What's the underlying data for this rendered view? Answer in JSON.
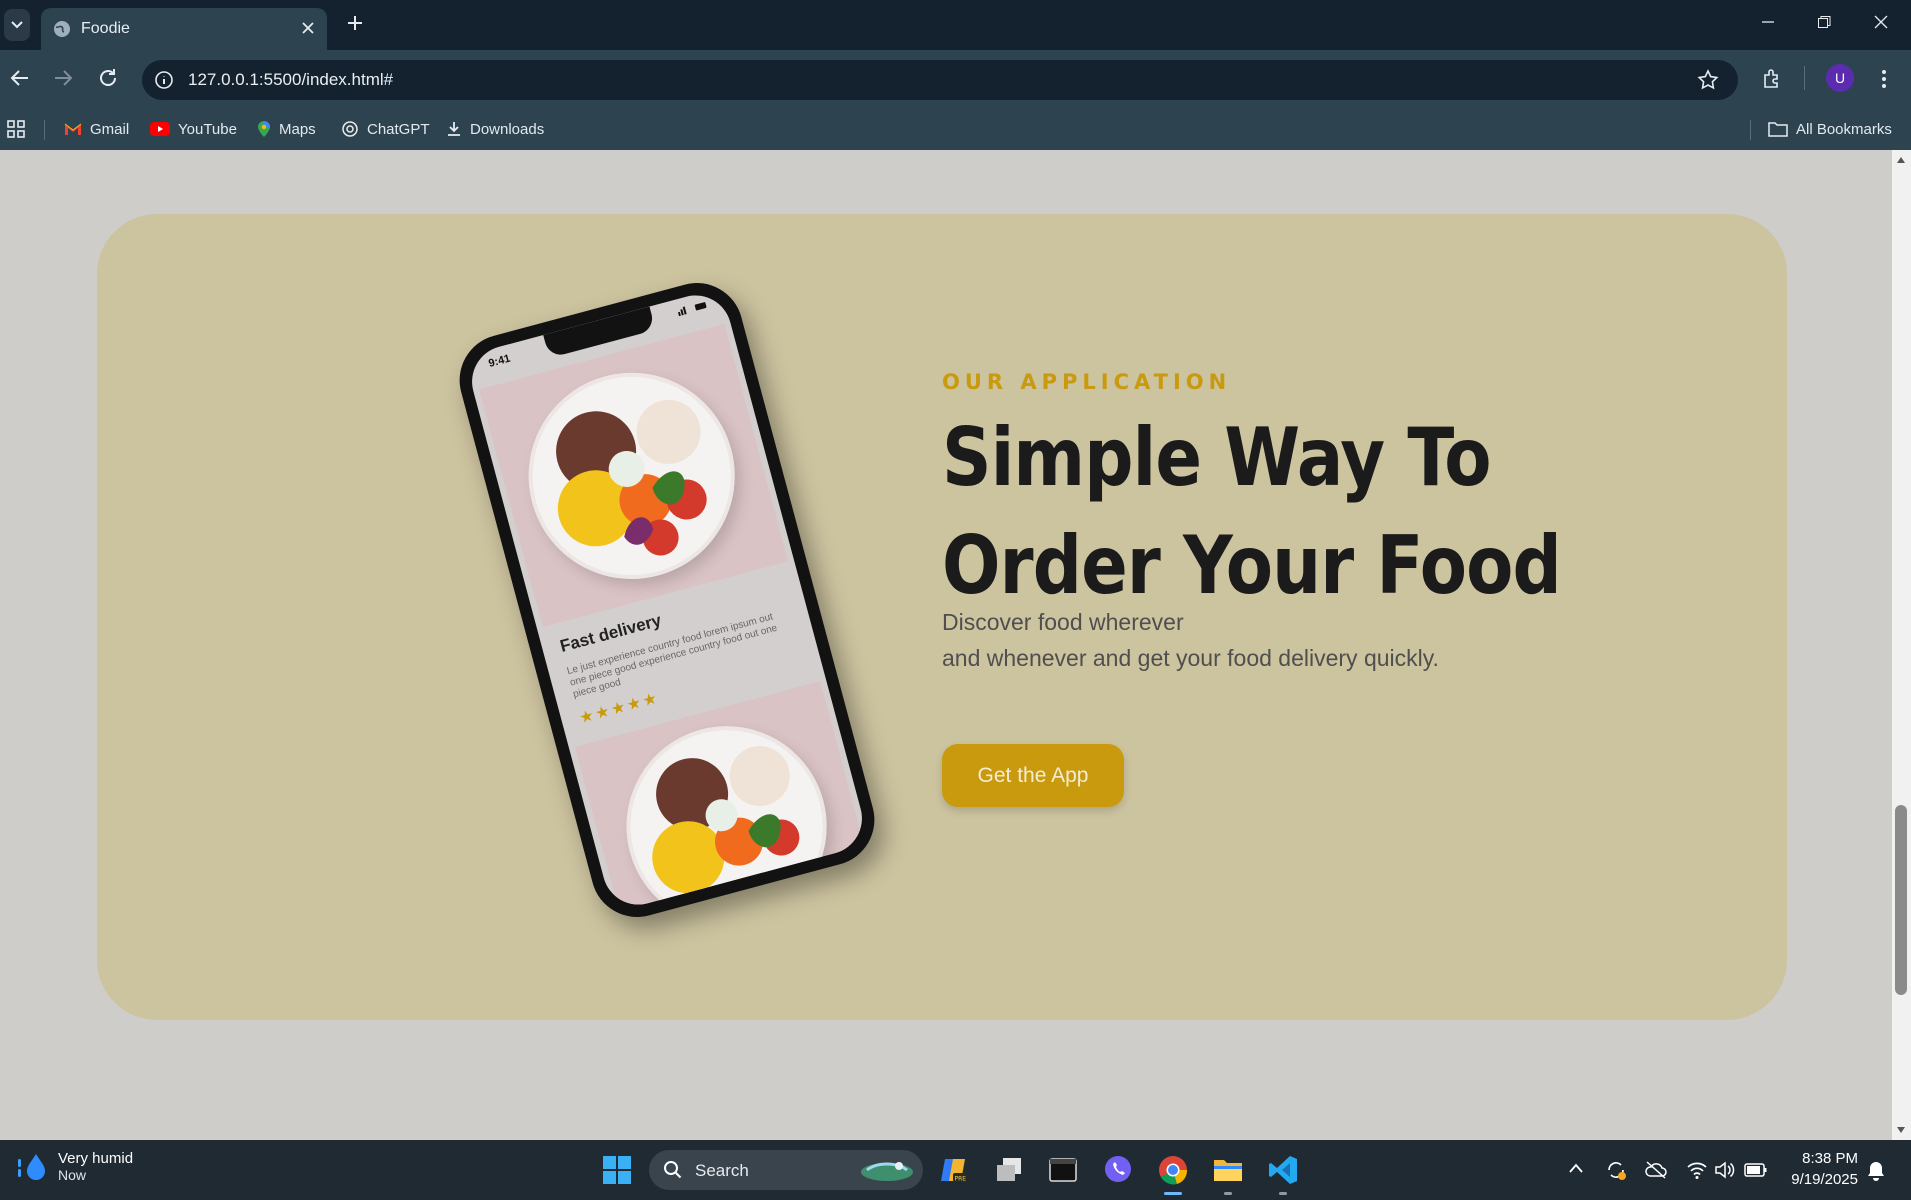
{
  "browser": {
    "tab_title": "Foodie",
    "url": "127.0.0.1:5500/index.html#",
    "profile_initial": "U",
    "bookmarks": [
      "Gmail",
      "YouTube",
      "Maps",
      "ChatGPT",
      "Downloads"
    ],
    "all_bookmarks": "All Bookmarks"
  },
  "page": {
    "eyebrow": "OUR APPLICATION",
    "headline_line1": "Simple Way To",
    "headline_line2": "Order Your Food",
    "desc_line1": "Discover food wherever",
    "desc_line2": "and whenever and get your food delivery quickly.",
    "cta_label": "Get the App",
    "phone": {
      "time": "9:41",
      "card_title": "Fast delivery",
      "card_text": "Le just experience country food lorem ipsum out one piece good experience country food out one piece good",
      "stars": "★★★★★"
    },
    "colors": {
      "accent": "#c99a0e",
      "card_bg": "#ccc39f",
      "page_bg": "#cfcdc9"
    }
  },
  "taskbar": {
    "weather_title": "Very humid",
    "weather_sub": "Now",
    "search_label": "Search",
    "time": "8:38 PM",
    "date": "9/19/2025"
  }
}
